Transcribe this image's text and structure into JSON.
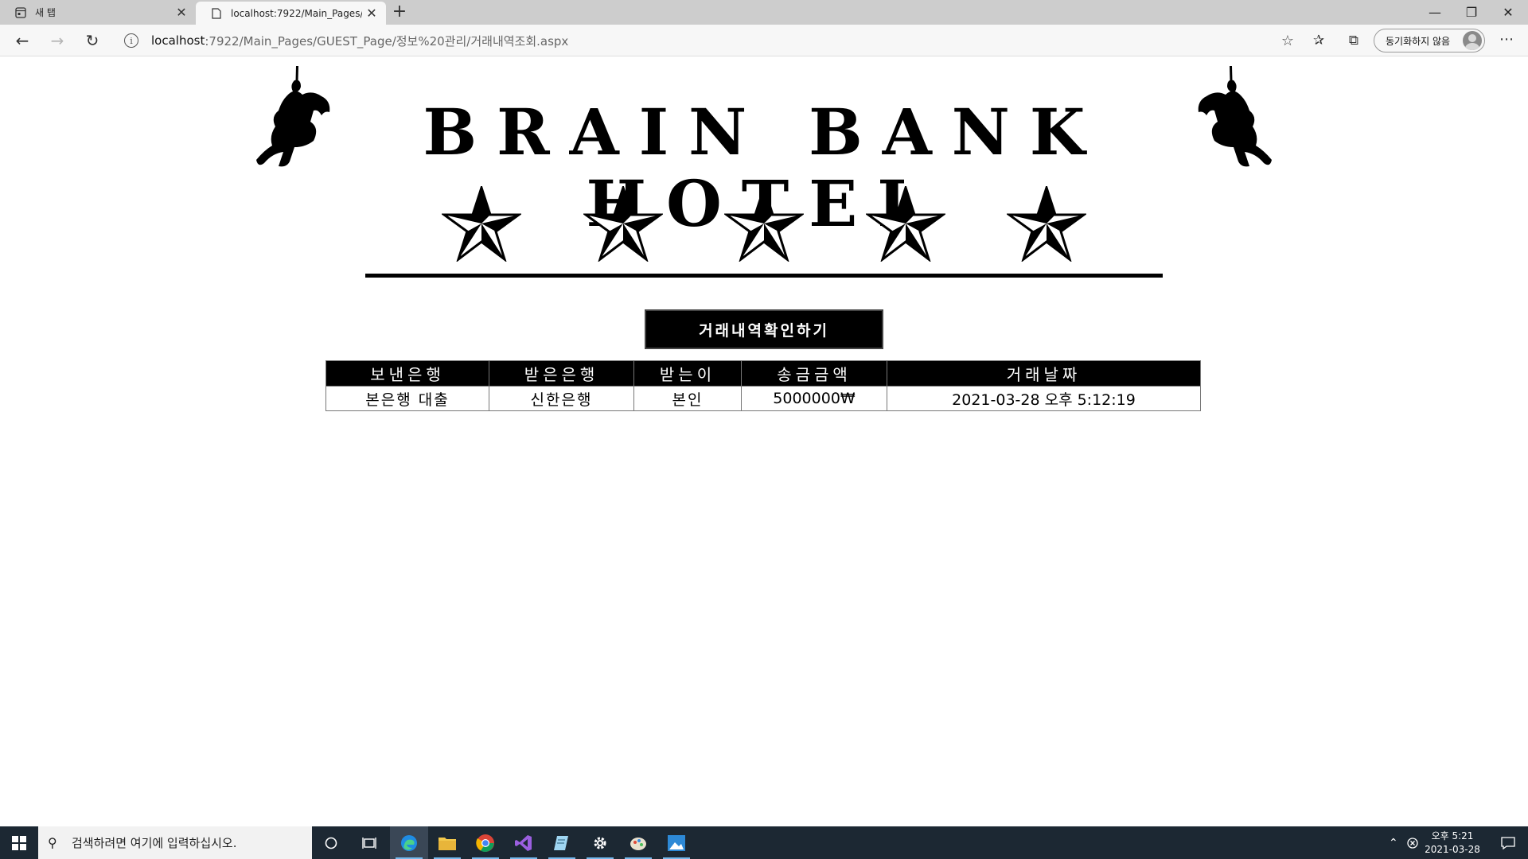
{
  "browser": {
    "tabs": [
      {
        "label": "새 탭"
      },
      {
        "label": "localhost:7922/Main_Pages/GUE"
      }
    ],
    "address": {
      "host": "localhost",
      "path": ":7922/Main_Pages/GUEST_Page/정보%20관리/거래내역조회.aspx"
    },
    "sync_label": "동기화하지 않음"
  },
  "page": {
    "hotel_title": "BRAIN BANK HOTEL",
    "star_count": 5,
    "check_button_label": "거래내역확인하기",
    "table": {
      "headers": [
        "보낸은행",
        "받은은행",
        "받는이",
        "송금금액",
        "거래날짜"
      ],
      "rows": [
        [
          "본은행 대출",
          "신한은행",
          "본인",
          "5000000₩",
          "2021-03-28 오후 5:12:19"
        ]
      ]
    }
  },
  "taskbar": {
    "search_placeholder": "검색하려면 여기에 입력하십시오.",
    "time": "오후 5:21",
    "date": "2021-03-28"
  }
}
